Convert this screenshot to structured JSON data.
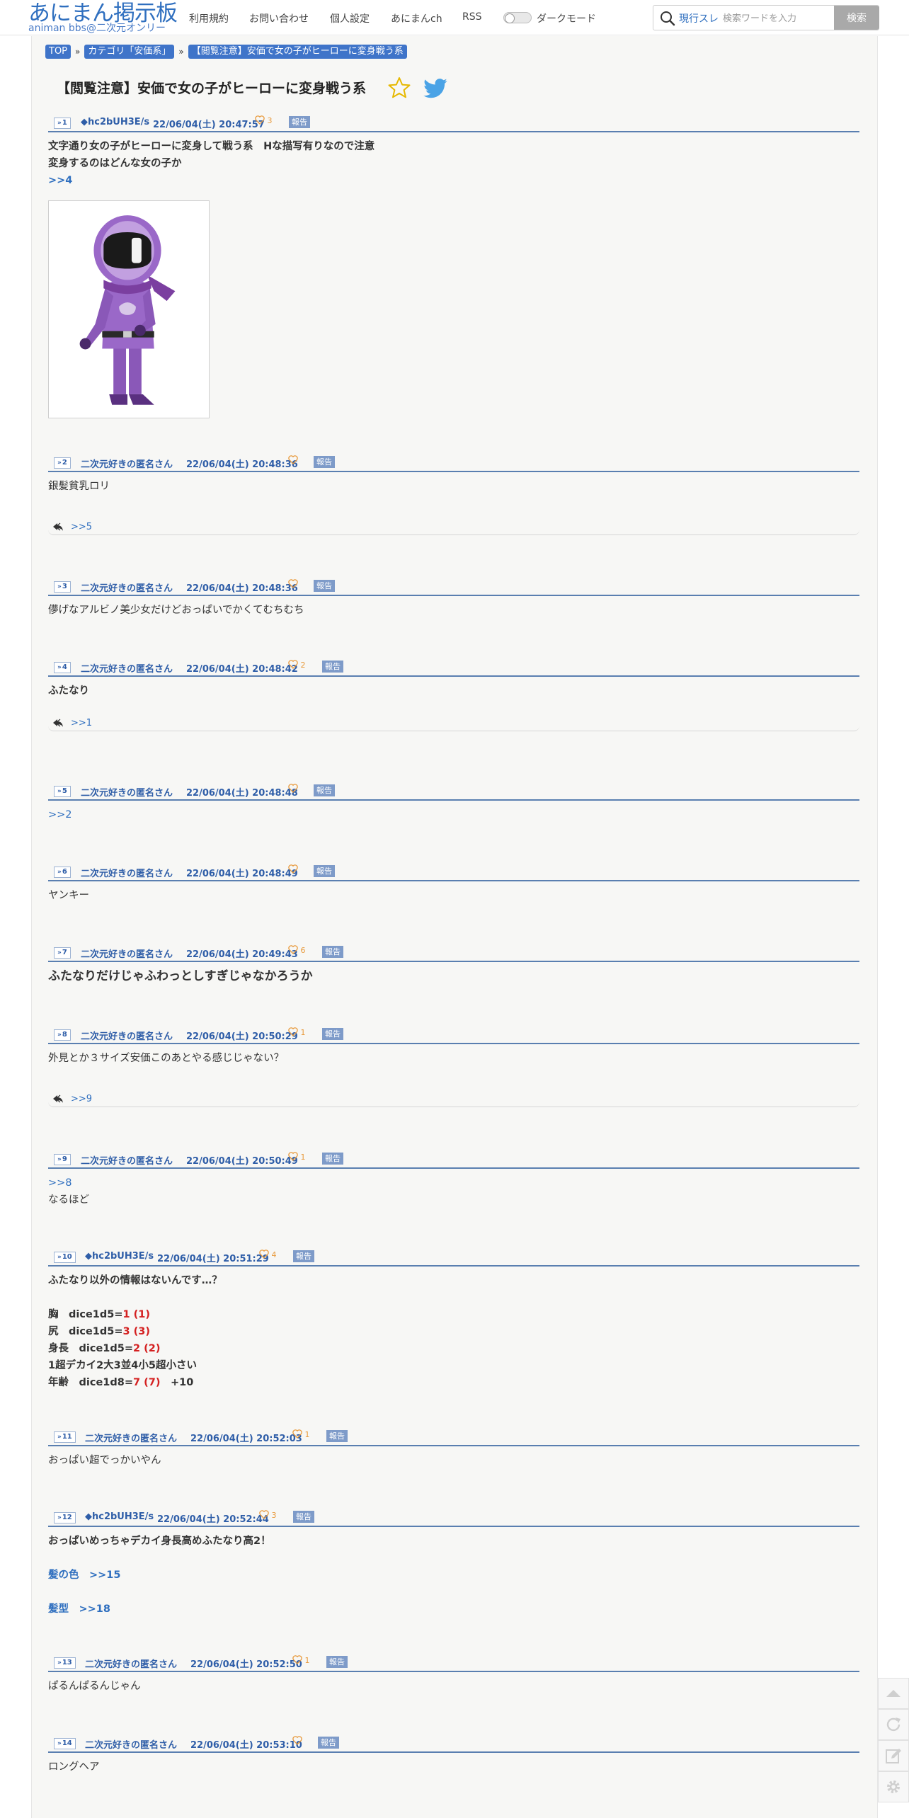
{
  "header": {
    "logo_main": "あにまん掲示板",
    "logo_sub": "animan bbs@二次元オンリー",
    "nav": [
      "利用規約",
      "お問い合わせ",
      "個人設定",
      "あにまんch",
      "RSS"
    ],
    "dark_mode_label": "ダークモード",
    "search_scope": "現行スレ",
    "search_placeholder": "検索ワードを入力",
    "search_button": "検索"
  },
  "breadcrumb": [
    "TOP",
    "カテゴリ「安価系」",
    "【閲覧注意】安価で女の子がヒーローに変身戦う系"
  ],
  "breadcrumb_sep": "»",
  "thread_title": "【閲覧注意】安価で女の子がヒーローに変身戦う系",
  "report_label": "報告",
  "posts": [
    {
      "num": "1",
      "poster": "◆hc2bUH3E/s",
      "date": "22/06/04(土) 20:47:57",
      "likes": "3",
      "lines": [
        "文字通り女の子がヒーローに変身して戦う系　Hな描写有りなので注意",
        "変身するのはどんな女の子か",
        ">>4"
      ],
      "reply": ""
    },
    {
      "num": "2",
      "poster": "二次元好きの匿名さん",
      "date": "22/06/04(土) 20:48:36",
      "likes": "",
      "lines": [
        "銀髪貧乳ロリ"
      ],
      "reply": ">>5"
    },
    {
      "num": "3",
      "poster": "二次元好きの匿名さん",
      "date": "22/06/04(土) 20:48:36",
      "likes": "",
      "lines": [
        "儚げなアルビノ美少女だけどおっぱいでかくてむちむち"
      ],
      "reply": ""
    },
    {
      "num": "4",
      "poster": "二次元好きの匿名さん",
      "date": "22/06/04(土) 20:48:42",
      "likes": "2",
      "lines": [
        "ふたなり"
      ],
      "reply": ">>1"
    },
    {
      "num": "5",
      "poster": "二次元好きの匿名さん",
      "date": "22/06/04(土) 20:48:48",
      "likes": "",
      "lines": [
        ">>2"
      ],
      "reply": ""
    },
    {
      "num": "6",
      "poster": "二次元好きの匿名さん",
      "date": "22/06/04(土) 20:48:49",
      "likes": "",
      "lines": [
        "ヤンキー"
      ],
      "reply": ""
    },
    {
      "num": "7",
      "poster": "二次元好きの匿名さん",
      "date": "22/06/04(土) 20:49:43",
      "likes": "6",
      "lines": [
        "ふたなりだけじゃふわっとしすぎじゃなかろうか"
      ],
      "reply": ""
    },
    {
      "num": "8",
      "poster": "二次元好きの匿名さん",
      "date": "22/06/04(土) 20:50:29",
      "likes": "1",
      "lines": [
        "外見とか３サイズ安価このあとやる感じじゃない？"
      ],
      "reply": ">>9"
    },
    {
      "num": "9",
      "poster": "二次元好きの匿名さん",
      "date": "22/06/04(土) 20:50:49",
      "likes": "1",
      "lines": [
        ">>8",
        "なるほど"
      ],
      "reply": ""
    },
    {
      "num": "10",
      "poster": "◆hc2bUH3E/s",
      "date": "22/06/04(土) 20:51:29",
      "likes": "4",
      "lines": [
        "ふたなり以外の情報はないんです…？",
        "",
        "胸　dice1d5=",
        "尻　dice1d5=",
        "身長　dice1d5=",
        "1超デカイ2大3並4小5超小さい",
        "年齢　dice1d8="
      ],
      "dice": [
        {
          "label": "胸　dice1d5=",
          "roll": "1",
          "total": "(1)",
          "extra": ""
        },
        {
          "label": "尻　dice1d5=",
          "roll": "3",
          "total": "(3)",
          "extra": ""
        },
        {
          "label": "身長　dice1d5=",
          "roll": "2",
          "total": "(2)",
          "extra": ""
        },
        {
          "label": "年齢　dice1d8=",
          "roll": "7",
          "total": "(7)",
          "extra": "　+10"
        }
      ],
      "reply": ""
    },
    {
      "num": "11",
      "poster": "二次元好きの匿名さん",
      "date": "22/06/04(土) 20:52:03",
      "likes": "1",
      "lines": [
        "おっぱい超でっかいやん"
      ],
      "reply": ""
    },
    {
      "num": "12",
      "poster": "◆hc2bUH3E/s",
      "date": "22/06/04(土) 20:52:44",
      "likes": "3",
      "lines": [
        "おっぱいめっちゃデカイ身長高めふたなり高2！",
        "",
        "髪の色　>>15",
        "",
        "髪型　>>18"
      ],
      "reply": ""
    },
    {
      "num": "13",
      "poster": "二次元好きの匿名さん",
      "date": "22/06/04(土) 20:52:50",
      "likes": "1",
      "lines": [
        "ぱるんぱるんじゃん"
      ],
      "reply": ""
    },
    {
      "num": "14",
      "poster": "二次元好きの匿名さん",
      "date": "22/06/04(土) 20:53:10",
      "likes": "",
      "lines": [
        "ロングヘア"
      ],
      "reply": ""
    }
  ],
  "colors": {
    "accent": "#2f6fbf",
    "rule": "#5a7fb0",
    "like": "#e89a3c",
    "dice": "#d42020"
  },
  "side_tools": [
    "scroll-top-icon",
    "reload-icon",
    "write-icon",
    "settings-icon"
  ]
}
